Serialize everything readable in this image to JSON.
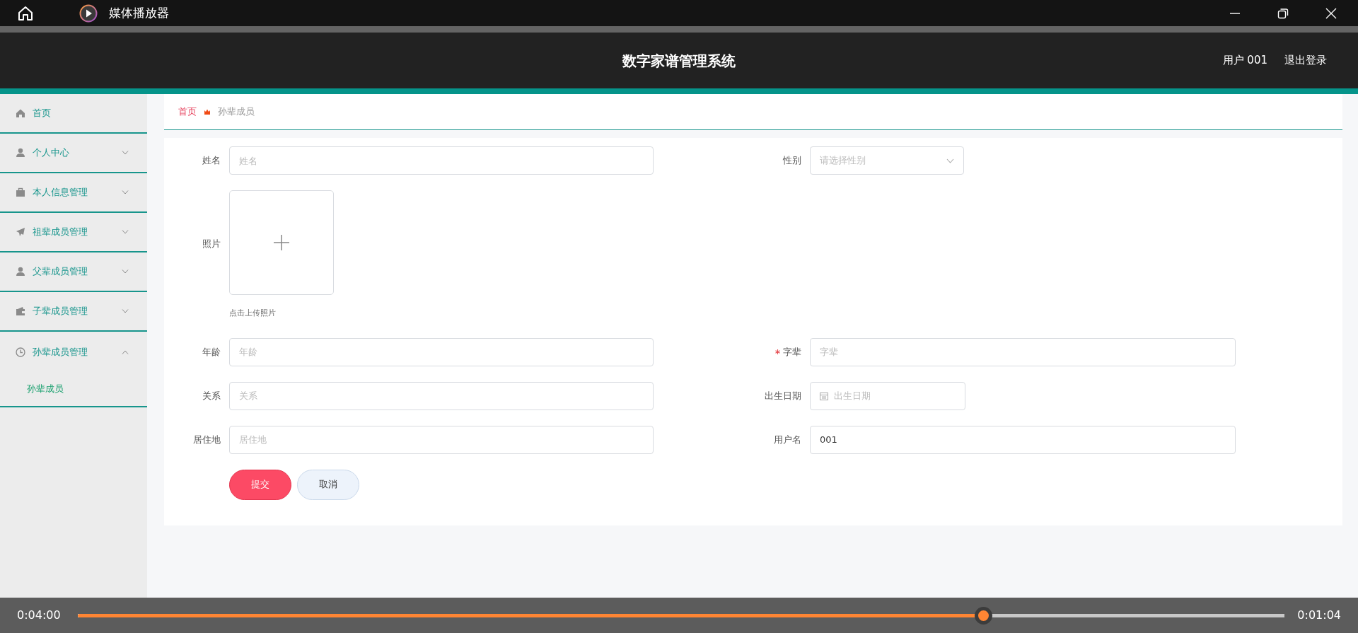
{
  "window": {
    "title": "媒体播放器"
  },
  "app": {
    "title": "数字家谱管理系统",
    "user": "用户 001",
    "logout": "退出登录"
  },
  "sidebar": {
    "items": [
      {
        "kind": "link",
        "label": "首页"
      },
      {
        "kind": "menu",
        "label": "个人中心",
        "expanded": false
      },
      {
        "kind": "menu",
        "label": "本人信息管理",
        "expanded": false
      },
      {
        "kind": "menu",
        "label": "祖辈成员管理",
        "expanded": false
      },
      {
        "kind": "menu",
        "label": "父辈成员管理",
        "expanded": false
      },
      {
        "kind": "menu",
        "label": "子辈成员管理",
        "expanded": false
      },
      {
        "kind": "menu",
        "label": "孙辈成员管理",
        "expanded": true,
        "children": [
          {
            "label": "孙辈成员"
          }
        ]
      }
    ]
  },
  "breadcrumb": [
    "首页",
    "孙辈成员"
  ],
  "form": {
    "rows": [
      {
        "fields": [
          {
            "kind": "text",
            "label": "姓名",
            "placeholder": "姓名",
            "required": false
          },
          {
            "kind": "select",
            "label": "性别",
            "placeholder": "请选择性别",
            "required": false
          }
        ]
      },
      {
        "fields": [
          {
            "kind": "upload",
            "label": "照片",
            "hint": "点击上传照片",
            "required": false
          }
        ]
      },
      {
        "fields": [
          {
            "kind": "text",
            "label": "年龄",
            "placeholder": "年龄",
            "required": false
          },
          {
            "kind": "text",
            "label": "字辈",
            "placeholder": "字辈",
            "required": true
          }
        ]
      },
      {
        "fields": [
          {
            "kind": "text",
            "label": "关系",
            "placeholder": "关系",
            "required": false
          },
          {
            "kind": "date",
            "label": "出生日期",
            "placeholder": "出生日期",
            "required": false
          }
        ]
      },
      {
        "fields": [
          {
            "kind": "text",
            "label": "居住地",
            "placeholder": "居住地",
            "required": false
          },
          {
            "kind": "text",
            "label": "用户名",
            "value": "001",
            "required": false
          }
        ]
      }
    ],
    "buttons": [
      {
        "kind": "primary",
        "label": "提交"
      },
      {
        "kind": "secondary",
        "label": "取消"
      }
    ]
  },
  "player": {
    "elapsed": "0:04:00",
    "remaining": "0:01:04",
    "level": 0.75
  }
}
